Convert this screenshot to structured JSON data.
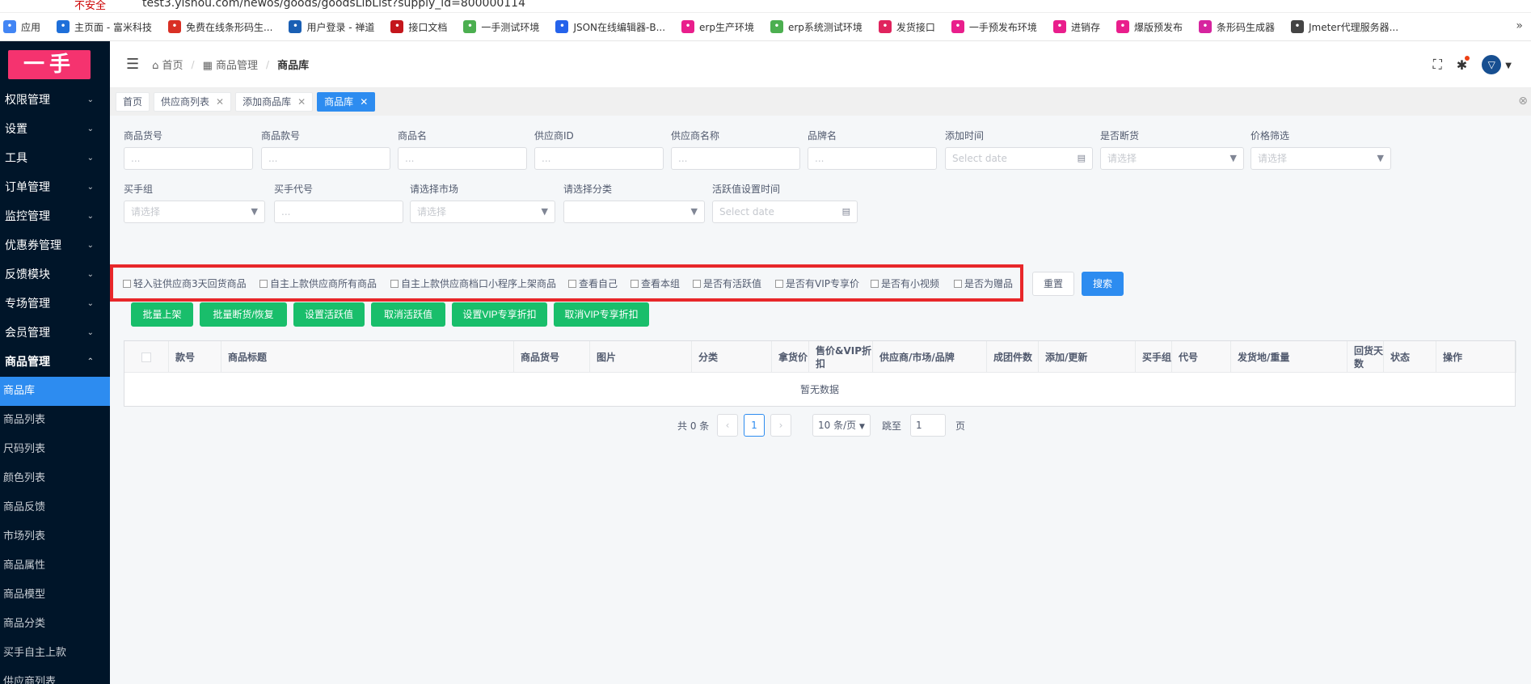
{
  "browser": {
    "warning": "不安全",
    "url": "test3.yishou.com/newos/goods/goodsLibList?supply_id=800000114",
    "bookmarks": [
      {
        "label": "应用",
        "icon": "apps-grid-icon",
        "color": "#4285f4"
      },
      {
        "label": "主页面 - 富米科技",
        "icon": "x-logo-icon",
        "color": "#1e6fd9"
      },
      {
        "label": "免费在线条形码生...",
        "icon": "barcode-site-icon",
        "color": "#d93025"
      },
      {
        "label": "用户登录 - 禅道",
        "icon": "zentao-icon",
        "color": "#1a5fb4"
      },
      {
        "label": "接口文档",
        "icon": "r-logo-icon",
        "color": "#c4161c"
      },
      {
        "label": "一手测试环境",
        "icon": "leaf-icon",
        "color": "#4caf50"
      },
      {
        "label": "JSON在线编辑器-B...",
        "icon": "json-icon",
        "color": "#2563eb"
      },
      {
        "label": "erp生产环境",
        "icon": "erp-icon",
        "color": "#e91e8c"
      },
      {
        "label": "erp系统测试环境",
        "icon": "leaf-icon",
        "color": "#4caf50"
      },
      {
        "label": "发货接口",
        "icon": "ship-icon",
        "color": "#e0245e"
      },
      {
        "label": "一手预发布环境",
        "icon": "erp-icon",
        "color": "#e91e8c"
      },
      {
        "label": "进销存",
        "icon": "erp-icon",
        "color": "#e91e8c"
      },
      {
        "label": "爆版预发布",
        "icon": "erp-icon",
        "color": "#e91e8c"
      },
      {
        "label": "条形码生成器",
        "icon": "barcode-gen-icon",
        "color": "#d6249f"
      },
      {
        "label": "Jmeter代理服务器...",
        "icon": "jmeter-icon",
        "color": "#444444"
      }
    ],
    "more": "»"
  },
  "logo": "一手",
  "sidebar": {
    "menus": [
      {
        "label": "权限管理"
      },
      {
        "label": "设置"
      },
      {
        "label": "工具"
      },
      {
        "label": "订单管理"
      },
      {
        "label": "监控管理"
      },
      {
        "label": "优惠券管理"
      },
      {
        "label": "反馈模块"
      },
      {
        "label": "专场管理"
      },
      {
        "label": "会员管理"
      },
      {
        "label": "商品管理"
      }
    ],
    "submenu": [
      "商品库",
      "商品列表",
      "尺码列表",
      "颜色列表",
      "商品反馈",
      "市场列表",
      "商品属性",
      "商品模型",
      "商品分类",
      "买手自主上款",
      "供应商列表"
    ],
    "active_sub": "商品库"
  },
  "header": {
    "breadcrumb": [
      "首页",
      "商品管理",
      "商品库"
    ]
  },
  "tabs": [
    {
      "label": "首页",
      "closable": false
    },
    {
      "label": "供应商列表",
      "closable": true
    },
    {
      "label": "添加商品库",
      "closable": true
    },
    {
      "label": "商品库",
      "closable": true,
      "active": true
    }
  ],
  "filters": {
    "row1": [
      {
        "label": "商品货号",
        "placeholder": "..."
      },
      {
        "label": "商品款号",
        "placeholder": "..."
      },
      {
        "label": "商品名",
        "placeholder": "..."
      },
      {
        "label": "供应商ID",
        "placeholder": "..."
      },
      {
        "label": "供应商名称",
        "placeholder": "..."
      },
      {
        "label": "品牌名",
        "placeholder": "..."
      },
      {
        "label": "添加时间",
        "placeholder": "Select date"
      },
      {
        "label": "是否断货",
        "placeholder": "请选择"
      },
      {
        "label": "价格筛选",
        "placeholder": "请选择"
      }
    ],
    "row2": [
      {
        "label": "买手组",
        "placeholder": "请选择"
      },
      {
        "label": "买手代号",
        "placeholder": "..."
      },
      {
        "label": "请选择市场",
        "placeholder": "请选择"
      },
      {
        "label": "请选择分类",
        "placeholder": ""
      },
      {
        "label": "活跃值设置时间",
        "placeholder": "Select date"
      }
    ]
  },
  "checkboxes": [
    "轻入驻供应商3天回货商品",
    "自主上款供应商所有商品",
    "自主上款供应商档口小程序上架商品",
    "查看自己",
    "查看本组",
    "是否有活跃值",
    "是否有VIP专享价",
    "是否有小视频",
    "是否为赠品"
  ],
  "buttons": {
    "reset": "重置",
    "search": "搜索",
    "actions": [
      "批量上架",
      "批量断货/恢复",
      "设置活跃值",
      "取消活跃值",
      "设置VIP专享折扣",
      "取消VIP专享折扣"
    ]
  },
  "table": {
    "columns": [
      "款号",
      "商品标题",
      "商品货号",
      "图片",
      "分类",
      "拿货价",
      "售价&VIP折扣",
      "供应商/市场/品牌",
      "成团件数",
      "添加/更新",
      "买手组",
      "代号",
      "发货地/重量",
      "回货天数",
      "状态",
      "操作"
    ],
    "empty": "暂无数据"
  },
  "pager": {
    "total": "共 0 条",
    "prev": "‹",
    "current": "1",
    "next": "›",
    "size": "10 条/页",
    "jump_label": "跳至",
    "jump_value": "1",
    "page_suffix": "页"
  },
  "colors": {
    "sidebar_bg": "#001529",
    "primary": "#2d8cf0",
    "success": "#19be6b",
    "highlight_border": "#e8272a",
    "logo_bg": "#f5336f"
  }
}
